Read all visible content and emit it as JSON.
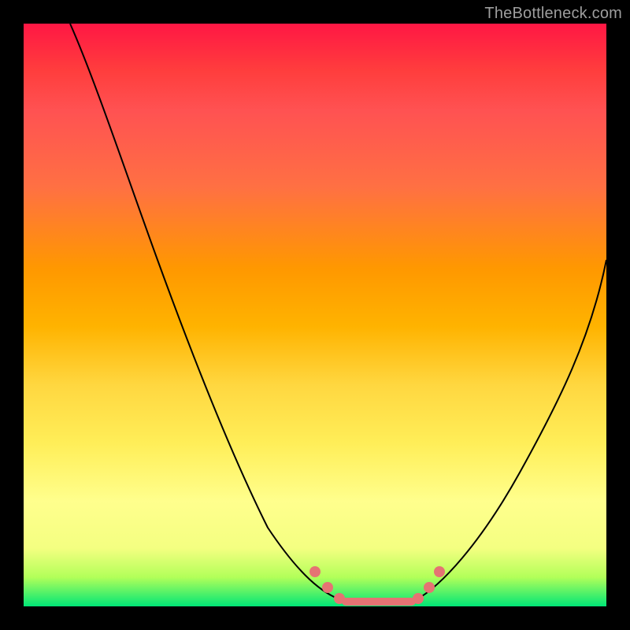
{
  "watermark": "TheBottleneck.com",
  "chart_data": {
    "type": "line",
    "title": "",
    "xlabel": "",
    "ylabel": "",
    "xlim": [
      0,
      100
    ],
    "ylim": [
      0,
      100
    ],
    "grid": false,
    "series": [
      {
        "name": "left-curve",
        "x": [
          8,
          12,
          16,
          20,
          24,
          28,
          32,
          36,
          40,
          44,
          48,
          52,
          55
        ],
        "y": [
          100,
          92,
          82,
          72,
          62,
          52,
          42,
          32,
          23,
          15,
          9,
          4,
          1
        ]
      },
      {
        "name": "plateau",
        "x": [
          55,
          58,
          61,
          64,
          67
        ],
        "y": [
          1,
          0,
          0,
          0,
          1
        ]
      },
      {
        "name": "right-curve",
        "x": [
          67,
          70,
          74,
          78,
          82,
          86,
          90,
          94,
          98,
          100
        ],
        "y": [
          1,
          4,
          10,
          17,
          25,
          33,
          41,
          49,
          56,
          60
        ]
      }
    ],
    "markers": {
      "name": "highlight-dots",
      "points": [
        {
          "x": 50,
          "y": 6
        },
        {
          "x": 52,
          "y": 3
        },
        {
          "x": 55,
          "y": 1
        },
        {
          "x": 66,
          "y": 1
        },
        {
          "x": 68,
          "y": 3
        },
        {
          "x": 70,
          "y": 6
        }
      ],
      "bar": {
        "x0": 55,
        "x1": 66,
        "y": 0
      }
    },
    "colors": {
      "gradient_top": "#ff1744",
      "gradient_mid": "#ffd740",
      "gradient_bottom": "#00e676",
      "curve": "#000000",
      "marker": "#e57373",
      "background": "#000000"
    }
  }
}
